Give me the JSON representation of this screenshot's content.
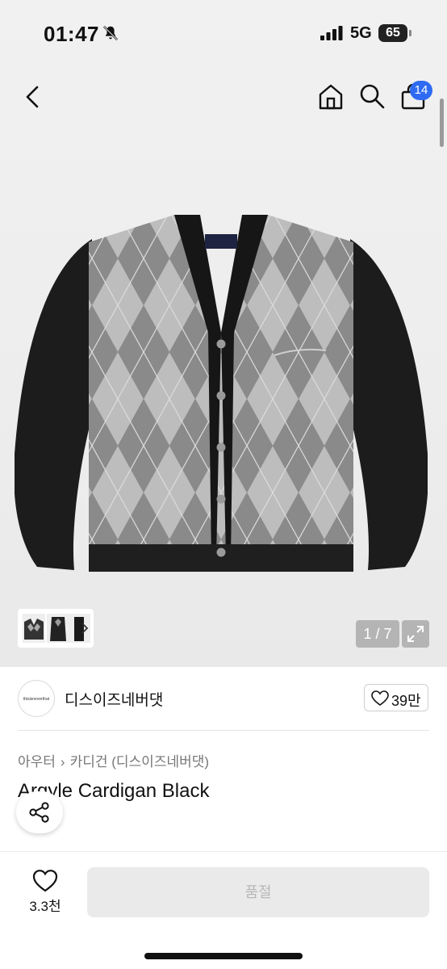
{
  "status_bar": {
    "time": "01:47",
    "network": "5G",
    "battery": "65"
  },
  "header": {
    "cart_count": "14"
  },
  "gallery": {
    "counter": "1 / 7"
  },
  "seller": {
    "logo_text": "thisisneverthat",
    "name": "디스이즈네버댓",
    "likes": "39만"
  },
  "product": {
    "breadcrumb": [
      "아우터",
      "카디건 (디스이즈네버댓)"
    ],
    "title": "Argyle Cardigan Black",
    "garment_label": "thisisneverthat"
  },
  "bottom_bar": {
    "wish_count": "3.3천",
    "buy_label": "품절"
  },
  "colors": {
    "badge_blue": "#2f6bf2",
    "soldout_bg": "#eaeaea",
    "soldout_text": "#b8b8b8"
  },
  "icons": [
    "bell-slash-icon",
    "signal-icon",
    "battery-icon",
    "back-icon",
    "home-icon",
    "search-icon",
    "bag-icon",
    "chevron-right-icon",
    "expand-icon",
    "heart-icon",
    "share-icon"
  ]
}
